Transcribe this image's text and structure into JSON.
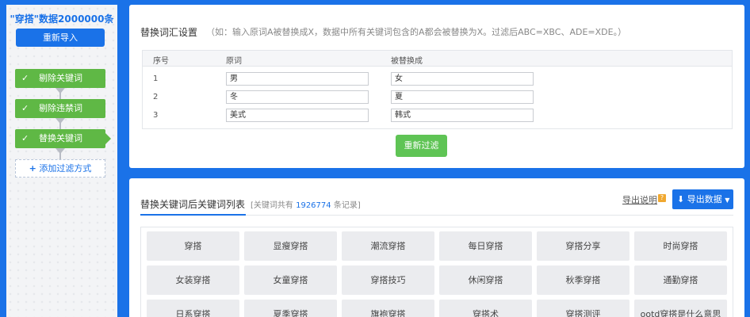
{
  "sidebar": {
    "title": "\"穿搭\"数据2000000条",
    "reimport_label": "重新导入",
    "steps": [
      {
        "label": "剔除关键词"
      },
      {
        "label": "剔除违禁词"
      },
      {
        "label": "替换关键词"
      }
    ],
    "add_filter_label": "添加过滤方式"
  },
  "replace_panel": {
    "title": "替换词汇设置",
    "hint": "（如：输入原词A被替换成X，数据中所有关键词包含的A都会被替换为X。过滤后ABC=XBC、ADE=XDE。）",
    "columns": [
      "序号",
      "原词",
      "被替换成"
    ],
    "rows": [
      {
        "num": "1",
        "original": "男",
        "replacement": "女"
      },
      {
        "num": "2",
        "original": "冬",
        "replacement": "夏"
      },
      {
        "num": "3",
        "original": "美式",
        "replacement": "韩式"
      }
    ],
    "refilter_label": "重新过滤"
  },
  "keyword_list": {
    "title": "替换关键词后关键词列表",
    "count_prefix": "[关键词共有",
    "count": "1926774",
    "count_suffix": "条记录]",
    "export_doc_label": "导出说明",
    "help_glyph": "?",
    "export_label": "导出数据",
    "keywords": [
      "穿搭",
      "显瘦穿搭",
      "潮流穿搭",
      "每日穿搭",
      "穿搭分享",
      "时尚穿搭",
      "女装穿搭",
      "女童穿搭",
      "穿搭技巧",
      "休闲穿搭",
      "秋季穿搭",
      "通勤穿搭",
      "日系穿搭",
      "夏季穿搭",
      "旗袍穿搭",
      "穿搭术",
      "穿搭测评",
      "ootd穿搭是什么意思"
    ]
  },
  "colors": {
    "accent": "#1a72e8",
    "step_green": "#5fb845",
    "button_green": "#5fc455",
    "help_orange": "#f0a830"
  }
}
